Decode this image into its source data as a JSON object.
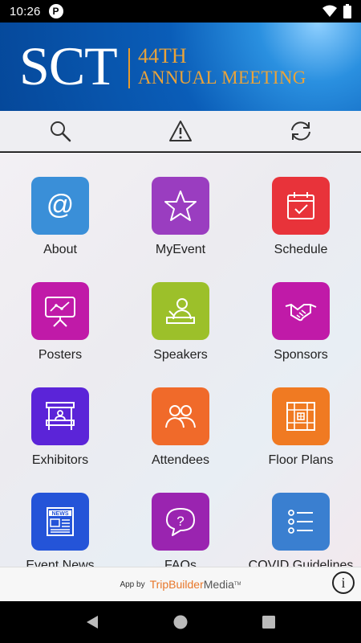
{
  "status_bar": {
    "time": "10:26",
    "app_badge": "P"
  },
  "banner": {
    "logo_text": "SCT",
    "line1": "44TH",
    "line2": "ANNUAL MEETING"
  },
  "toolbar": {
    "items": [
      {
        "icon": "search-icon"
      },
      {
        "icon": "alert-icon"
      },
      {
        "icon": "refresh-icon"
      }
    ]
  },
  "grid": {
    "items": [
      {
        "label": "About",
        "color": "#3a8fd8",
        "icon": "at-icon"
      },
      {
        "label": "MyEvent",
        "color": "#9a3dc0",
        "icon": "star-icon"
      },
      {
        "label": "Schedule",
        "color": "#e8333a",
        "icon": "calendar-icon"
      },
      {
        "label": "Posters",
        "color": "#c01aa8",
        "icon": "poster-icon"
      },
      {
        "label": "Speakers",
        "color": "#9cc02a",
        "icon": "speaker-icon"
      },
      {
        "label": "Sponsors",
        "color": "#c01aa8",
        "icon": "handshake-icon"
      },
      {
        "label": "Exhibitors",
        "color": "#5b24d8",
        "icon": "booth-icon"
      },
      {
        "label": "Attendees",
        "color": "#f06a2a",
        "icon": "people-icon"
      },
      {
        "label": "Floor Plans",
        "color": "#f07a22",
        "icon": "floorplan-icon"
      },
      {
        "label": "Event News",
        "color": "#2454d8",
        "icon": "news-icon"
      },
      {
        "label": "FAQs",
        "color": "#9a24b0",
        "icon": "faq-icon"
      },
      {
        "label": "COVID Guidelines",
        "color": "#3a7fd0",
        "icon": "list-icon"
      }
    ]
  },
  "footer": {
    "app_by": "App by",
    "brand_trip": "TripBuilder",
    "brand_media": "Media",
    "trademark": "TM",
    "info_label": "i"
  },
  "colors": {
    "banner_blue": "#0a5db8",
    "banner_gold": "#e9a33a",
    "brand_orange": "#e8772a"
  }
}
